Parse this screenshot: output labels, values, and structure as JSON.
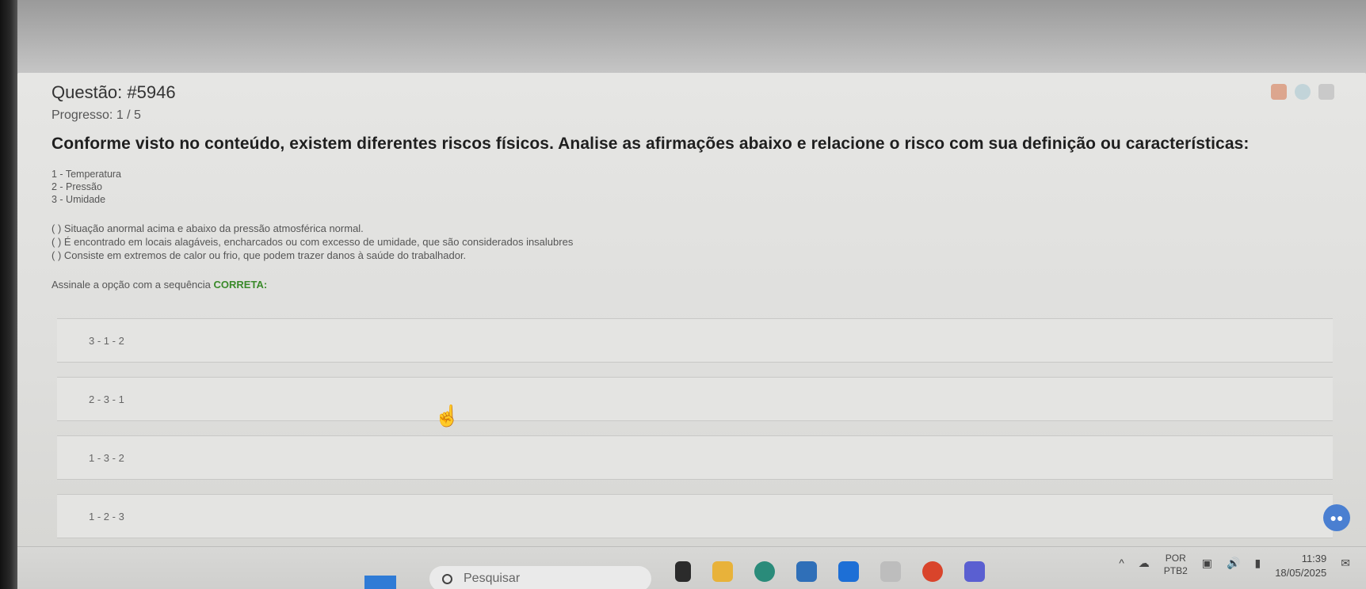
{
  "question": {
    "title": "Questão: #5946",
    "progress": "Progresso: 1 / 5",
    "statement": "Conforme visto no conteúdo, existem diferentes riscos físicos. Analise as afirmações abaixo e relacione o risco com sua definição ou características:",
    "legend": [
      "1 - Temperatura",
      "2 - Pressão",
      "3 - Umidade"
    ],
    "items": [
      "( ) Situação anormal acima e abaixo da pressão atmosférica normal.",
      "( ) É encontrado em locais alagáveis, encharcados ou com excesso de umidade, que são considerados insalubres",
      "( ) Consiste em extremos de calor ou frio, que podem trazer danos à saúde do trabalhador."
    ],
    "instruction_prefix": "Assinale a opção com a sequência ",
    "instruction_highlight": "CORRETA:",
    "options": [
      "3 - 1 - 2",
      "2 - 3 - 1",
      "1 - 3 - 2",
      "1 - 2 - 3"
    ]
  },
  "taskbar": {
    "search_placeholder": "Pesquisar",
    "lang_top": "POR",
    "lang_bottom": "PTB2",
    "time": "11:39",
    "date": "18/05/2025"
  },
  "icons": {
    "start": "windows-icon",
    "search": "magnifier-icon",
    "cursor": "hand-pointer-icon",
    "chat": "chat-icon"
  }
}
